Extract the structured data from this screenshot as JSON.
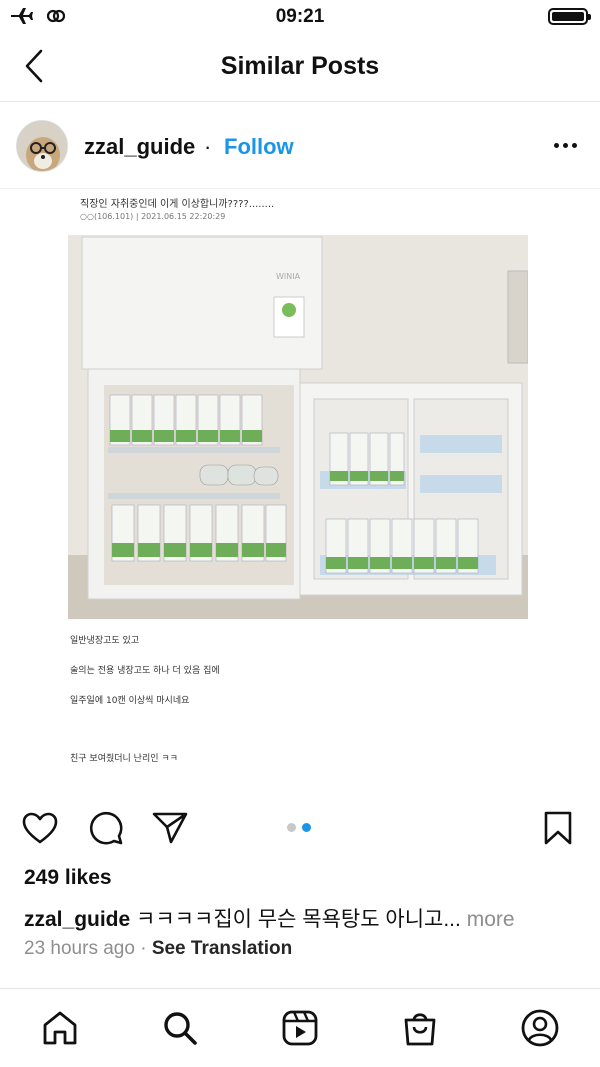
{
  "status_bar": {
    "time": "09:21"
  },
  "header": {
    "title": "Similar Posts"
  },
  "post": {
    "username": "zzal_guide",
    "separator": "·",
    "follow_label": "Follow",
    "image": {
      "title": "직장인 자취중인데 이게 이상합니까????........",
      "meta": "○○(106.101)  |  2021.06.15 22:20:29",
      "lines": [
        "일반냉장고도 있고",
        "술의는 전용 냉장고도 하나 더 있음 집에",
        "일주일에 10캔 이상씩 마시네요",
        "친구 보여줬더니 난리인 ㅋㅋ"
      ],
      "fridge_brand": "WINIA"
    },
    "likes": "249 likes",
    "caption_user": "zzal_guide",
    "caption_text": "ㅋㅋㅋㅋ집이 무슨 목욕탕도 아니고...",
    "caption_more": "more",
    "time_ago": "23 hours ago",
    "time_separator": "·",
    "see_translation": "See Translation"
  },
  "icons": {
    "status": [
      "airplane-icon",
      "link-icon",
      "battery-icon"
    ],
    "actions": [
      "heart-icon",
      "comment-icon",
      "share-icon",
      "bookmark-icon"
    ],
    "nav": [
      "home-icon",
      "search-icon",
      "reels-icon",
      "shop-icon",
      "profile-icon"
    ]
  },
  "colors": {
    "accent": "#1a95e8",
    "muted": "#8e8e8e",
    "divider": "#e6e6e6"
  }
}
